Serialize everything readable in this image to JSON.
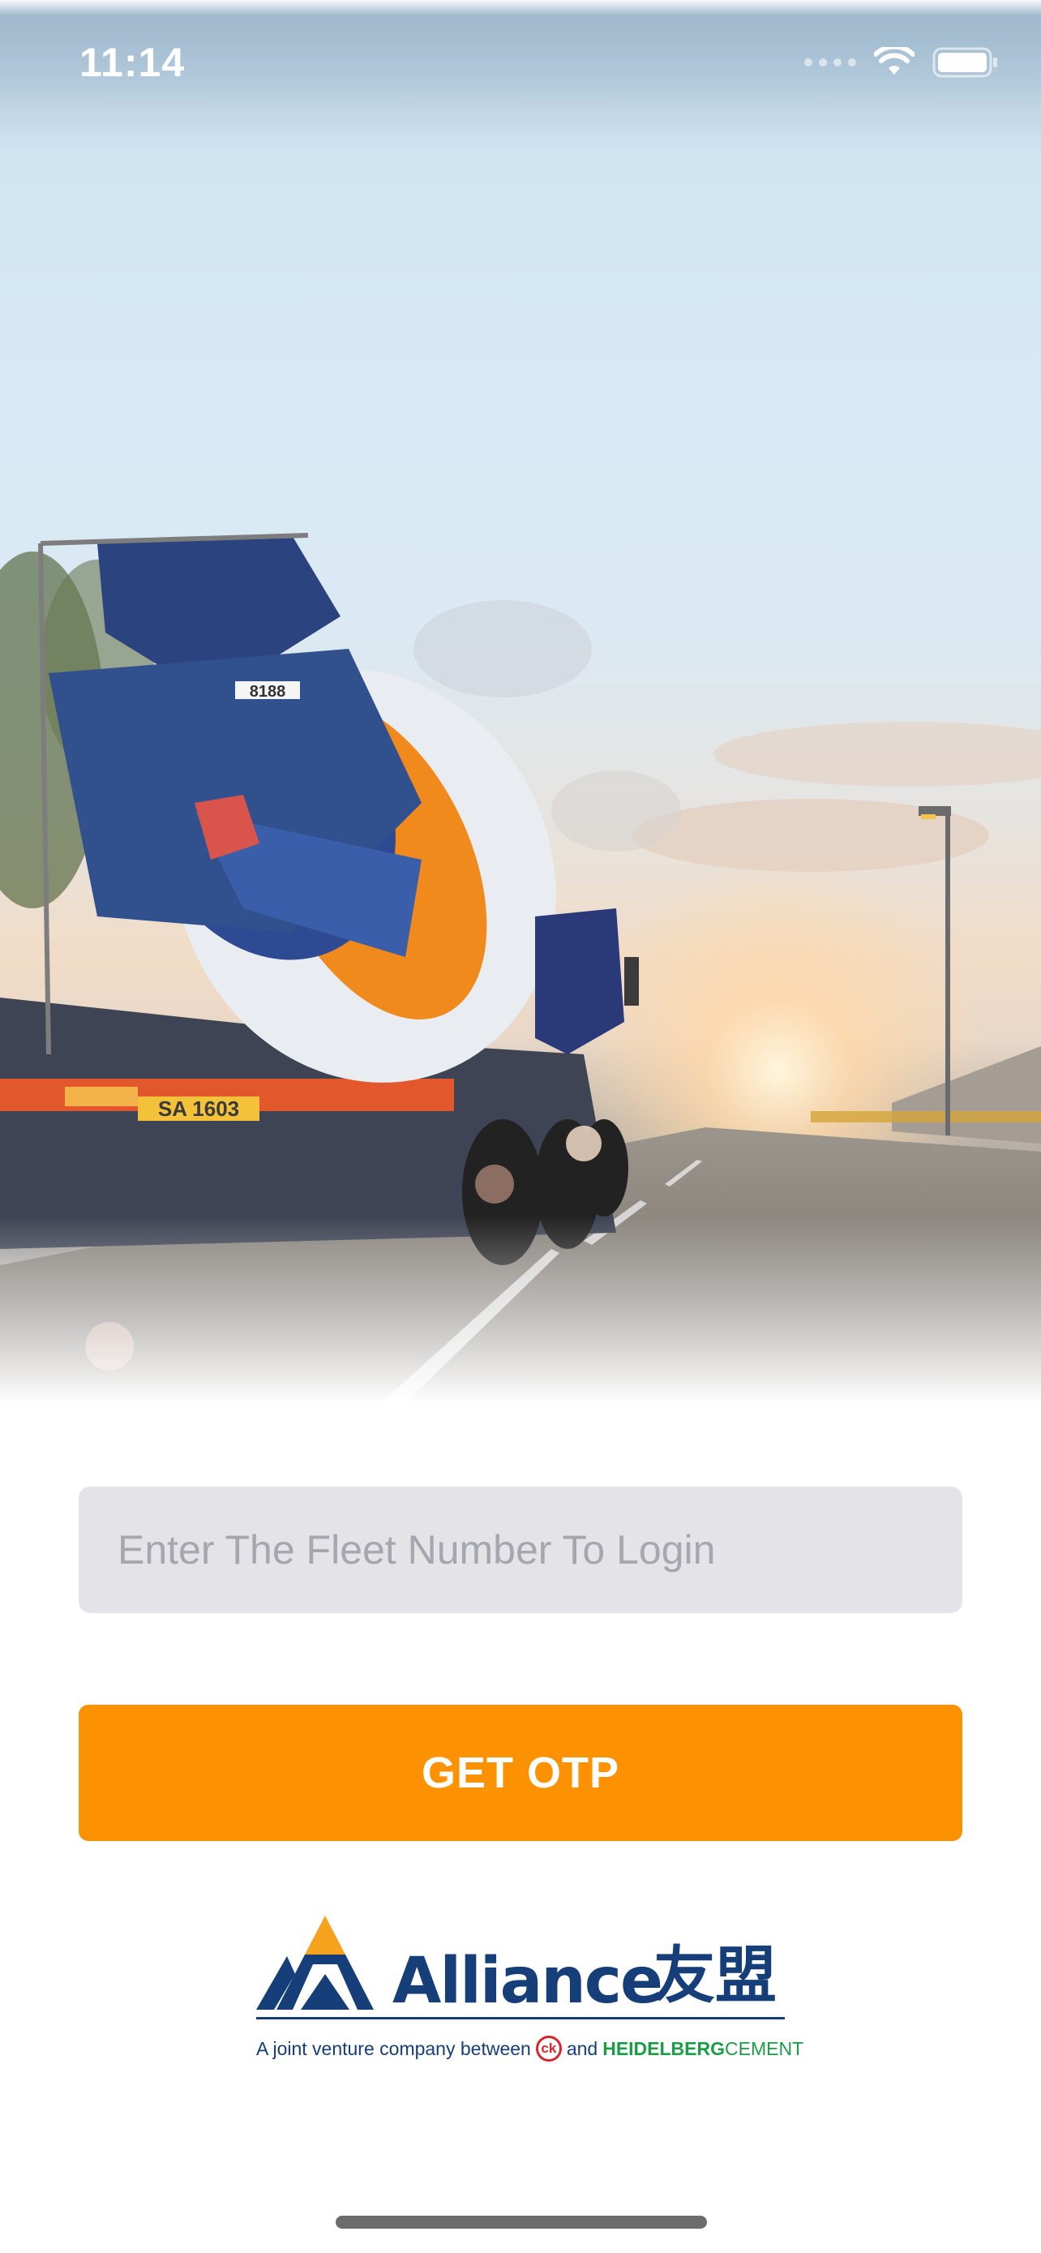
{
  "status_bar": {
    "time": "11:14"
  },
  "login": {
    "fleet_placeholder": "Enter The Fleet Number To Login",
    "fleet_value": "",
    "otp_button_label": "GET OTP"
  },
  "logo": {
    "name": "Alliance",
    "name_cjk": "友盟",
    "tagline_prefix": "A joint venture company between",
    "tagline_and": "and",
    "partner_heidelberg": "HEIDELBERG",
    "partner_cement": "CEMENT"
  },
  "hero": {
    "truck_plate": "SA 1603",
    "truck_number": "8188"
  },
  "colors": {
    "accent": "#fc9202",
    "input_bg": "#e3e3e8",
    "brand_blue": "#163e78",
    "partner_green": "#1a9e45",
    "partner_red": "#d7262e"
  },
  "icons": [
    "signal-icon",
    "wifi-icon",
    "battery-icon",
    "alliance-logo-mark",
    "home-indicator"
  ]
}
